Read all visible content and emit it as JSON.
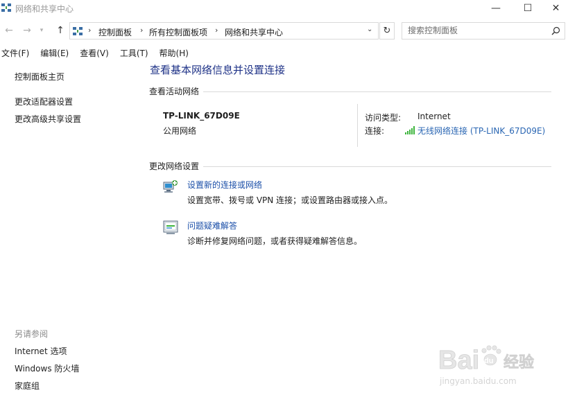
{
  "window": {
    "title": "网络和共享中心",
    "minimize_glyph": "—",
    "maximize_glyph": "☐",
    "close_glyph": "✕"
  },
  "address": {
    "breadcrumbs": [
      "控制面板",
      "所有控制面板项",
      "网络和共享中心"
    ],
    "search_placeholder": "搜索控制面板"
  },
  "menu": {
    "items": [
      "文件(F)",
      "编辑(E)",
      "查看(V)",
      "工具(T)",
      "帮助(H)"
    ]
  },
  "sidebar": {
    "items": [
      "控制面板主页",
      "更改适配器设置",
      "更改高级共享设置"
    ],
    "see_also_heading": "另请参阅",
    "see_also": [
      "Internet 选项",
      "Windows 防火墙",
      "家庭组"
    ]
  },
  "main": {
    "title": "查看基本网络信息并设置连接",
    "active_heading": "查看活动网络",
    "network": {
      "name": "TP-LINK_67D09E",
      "category": "公用网络",
      "access_label": "访问类型:",
      "access_value": "Internet",
      "connection_label": "连接:",
      "connection_value": "无线网络连接 (TP-LINK_67D09E)"
    },
    "change_heading": "更改网络设置",
    "tasks": [
      {
        "title": "设置新的连接或网络",
        "desc": "设置宽带、拨号或 VPN 连接；或设置路由器或接入点。",
        "icon": "network-setup-icon"
      },
      {
        "title": "问题疑难解答",
        "desc": "诊断并修复网络问题，或者获得疑难解答信息。",
        "icon": "troubleshoot-icon"
      }
    ]
  },
  "watermark": {
    "brand": "Bai",
    "brand2": "du",
    "cn": "经验",
    "url": "jingyan.baidu.com"
  },
  "colors": {
    "link": "#2a66b3",
    "title": "#1e3287",
    "wifi": "#3cb43c"
  }
}
